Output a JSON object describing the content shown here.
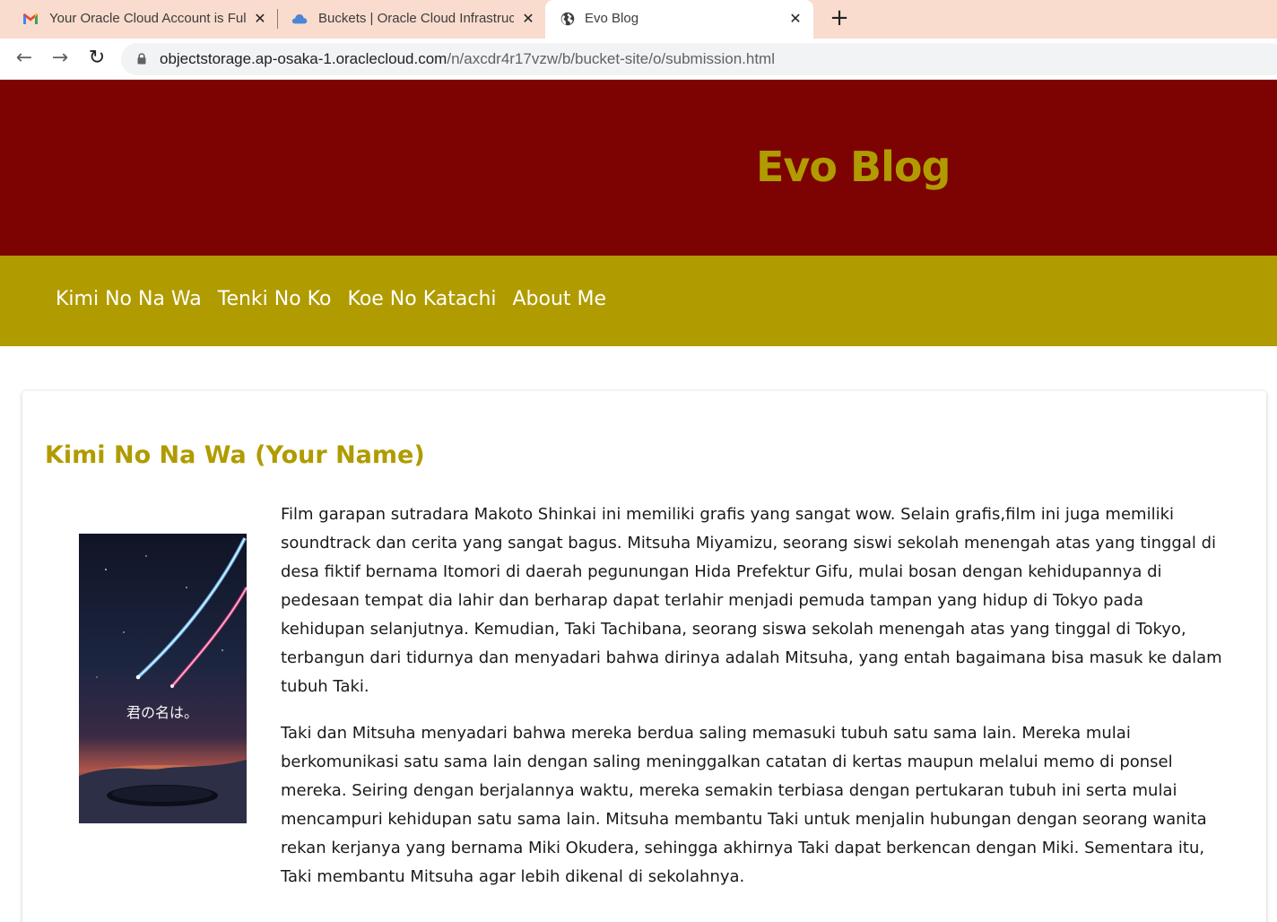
{
  "browser": {
    "tabs": [
      {
        "title": "Your Oracle Cloud Account is Full",
        "favicon": "gmail-icon"
      },
      {
        "title": "Buckets | Oracle Cloud Infrastructure",
        "favicon": "cloud-icon"
      },
      {
        "title": "Evo Blog",
        "favicon": "globe-icon",
        "active": true
      }
    ],
    "new_tab": "+",
    "url_host": "objectstorage.ap-osaka-1.oraclecloud.com",
    "url_path": "/n/axcdr4r17vzw/b/bucket-site/o/submission.html"
  },
  "site": {
    "title": "Evo Blog",
    "nav": [
      "Kimi No Na Wa",
      "Tenki No Ko",
      "Koe No Katachi",
      "About Me"
    ]
  },
  "post": {
    "title": "Kimi No Na Wa (Your Name)",
    "paragraphs": [
      "Film garapan sutradara Makoto Shinkai ini memiliki grafis yang sangat wow. Selain grafis,film ini juga memiliki soundtrack dan cerita yang sangat bagus. Mitsuha Miyamizu, seorang siswi sekolah menengah atas yang tinggal di desa fiktif bernama Itomori di daerah pegunungan Hida Prefektur Gifu, mulai bosan dengan kehidupannya di pedesaan tempat dia lahir dan berharap dapat terlahir menjadi pemuda tampan yang hidup di Tokyo pada kehidupan selanjutnya. Kemudian, Taki Tachibana, seorang siswa sekolah menengah atas yang tinggal di Tokyo, terbangun dari tidurnya dan menyadari bahwa dirinya adalah Mitsuha, yang entah bagaimana bisa masuk ke dalam tubuh Taki.",
      "Taki dan Mitsuha menyadari bahwa mereka berdua saling memasuki tubuh satu sama lain. Mereka mulai berkomunikasi satu sama lain dengan saling meninggalkan catatan di kertas maupun melalui memo di ponsel mereka. Seiring dengan berjalannya waktu, mereka semakin terbiasa dengan pertukaran tubuh ini serta mulai mencampuri kehidupan satu sama lain. Mitsuha membantu Taki untuk menjalin hubungan dengan seorang wanita rekan kerjanya yang bernama Miki Okudera, sehingga akhirnya Taki dapat berkencan dengan Miki. Sementara itu, Taki membantu Mitsuha agar lebih dikenal di sekolahnya."
    ],
    "poster_text": "君の名は。"
  },
  "colors": {
    "header_bg": "#7c0302",
    "accent": "#b09b00",
    "tabstrip_bg": "#f9dccd"
  }
}
